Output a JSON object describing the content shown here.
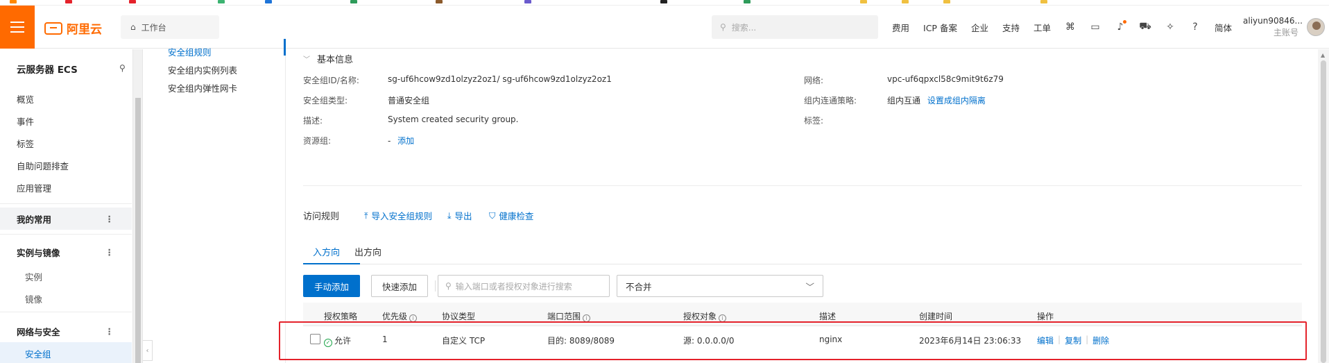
{
  "topbar": {
    "logo_text": "阿里云",
    "workbench_label": "工作台",
    "search_placeholder": "搜索...",
    "nav": [
      "费用",
      "ICP 备案",
      "企业",
      "支持",
      "工单"
    ],
    "lang": "简体",
    "user_name": "aliyun90846...",
    "user_role": "主账号",
    "accent_color": "#ff6a00"
  },
  "sidebar": {
    "title": "云服务器 ECS",
    "items": [
      "概览",
      "事件",
      "标签",
      "自助问题排查",
      "应用管理"
    ],
    "groups": [
      {
        "label": "我的常用",
        "subs": []
      },
      {
        "label": "实例与镜像",
        "subs": [
          "实例",
          "镜像"
        ]
      },
      {
        "label": "网络与安全",
        "subs": [
          "安全组"
        ]
      }
    ]
  },
  "subnav": {
    "items": [
      "安全组规则",
      "安全组内实例列表",
      "安全组内弹性网卡"
    ]
  },
  "basic_info": {
    "section_title": "基本信息",
    "left": [
      {
        "label": "安全组ID/名称:",
        "value": "sg-uf6hcow9zd1olzyz2oz1/ sg-uf6hcow9zd1olzyz2oz1"
      },
      {
        "label": "安全组类型:",
        "value": "普通安全组"
      },
      {
        "label": "描述:",
        "value": "System created security group."
      },
      {
        "label": "资源组:",
        "value": "-",
        "link": "添加"
      }
    ],
    "right": [
      {
        "label": "网络:",
        "value": "vpc-uf6qpxcl58c9mit9t6z79"
      },
      {
        "label": "组内连通策略:",
        "value": "组内互通",
        "link": "设置成组内隔离"
      },
      {
        "label": "标签:",
        "value": ""
      }
    ]
  },
  "rules": {
    "title": "访问规则",
    "actions": [
      "导入安全组规则",
      "导出",
      "健康检查"
    ],
    "tabs": [
      "入方向",
      "出方向"
    ],
    "add_manual": "手动添加",
    "add_quick": "快速添加",
    "search_placeholder": "输入端口或者授权对象进行搜索",
    "merge_select": "不合并",
    "columns": [
      "授权策略",
      "优先级",
      "协议类型",
      "端口范围",
      "授权对象",
      "描述",
      "创建时间",
      "操作"
    ],
    "rows": [
      {
        "policy": "允许",
        "priority": "1",
        "protocol": "自定义 TCP",
        "port": "目的: 8089/8089",
        "source": "源: 0.0.0.0/0",
        "desc": "nginx",
        "created": "2023年6月14日 23:06:33",
        "ops": [
          "编辑",
          "复制",
          "删除"
        ]
      }
    ]
  }
}
